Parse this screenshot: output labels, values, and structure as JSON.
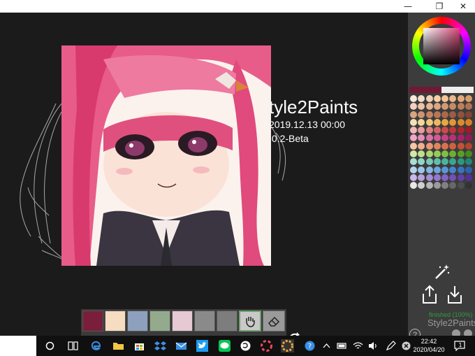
{
  "window": {
    "minimize_glyph": "—",
    "restore_glyph": "❐",
    "close_glyph": "✕"
  },
  "splash": {
    "app_name": "tyle2Paints",
    "build_date": "2019.12.13 00:00",
    "version": ".0.2-Beta"
  },
  "sidebar": {
    "collapse_glyph": "‹",
    "primary_color": "#6e1a37",
    "secondary_color": "#eeeeee",
    "palette": [
      "#f7e9dd",
      "#f3dcc8",
      "#efd1b7",
      "#f5cfa7",
      "#f0c494",
      "#e9b889",
      "#e2aa79",
      "#d89c6c",
      "#f1d0c0",
      "#ecc3a6",
      "#e6b593",
      "#dea683",
      "#d49874",
      "#c98a66",
      "#bf7e5b",
      "#b27252",
      "#d9a47f",
      "#cf9470",
      "#c48463",
      "#b77657",
      "#a9694d",
      "#9c5d45",
      "#8f523d",
      "#7f4635",
      "#f4e2b8",
      "#f2d79b",
      "#efca7c",
      "#eab95e",
      "#e6a844",
      "#e39636",
      "#df8a2b",
      "#dc7f23",
      "#f1b8b8",
      "#e89c9c",
      "#e07f80",
      "#d76264",
      "#cc494d",
      "#c0353b",
      "#b0262e",
      "#9c1b25",
      "#f0a6c8",
      "#e78cb8",
      "#dd71a6",
      "#d25896",
      "#c74285",
      "#b93075",
      "#a82366",
      "#951959",
      "#f6c7a4",
      "#f1b08c",
      "#e99874",
      "#e2835f",
      "#d9704e",
      "#cf6041",
      "#c35236",
      "#b4452c",
      "#d4e8a6",
      "#bfe08a",
      "#a9d66f",
      "#93cc58",
      "#7ebf45",
      "#69b034",
      "#589f28",
      "#478c1e",
      "#a8e0d2",
      "#8fd6c5",
      "#77cab7",
      "#5fbfa9",
      "#4bb39b",
      "#39a68d",
      "#2b9880",
      "#1f8973",
      "#b5d3ef",
      "#9dc4ea",
      "#86b5e4",
      "#6fa5de",
      "#5a95d6",
      "#4784cd",
      "#3773c1",
      "#2a63b2",
      "#c9b8ea",
      "#b8a2e2",
      "#a68cd9",
      "#9577cf",
      "#8363c4",
      "#7350b8",
      "#633fa9",
      "#543198",
      "#e8e8e8",
      "#cfcfcf",
      "#b5b5b5",
      "#9b9b9b",
      "#818181",
      "#676767",
      "#4d4d4d",
      "#333333"
    ],
    "status": "finished (100%)",
    "app_label": "Style2Paints",
    "help": "?"
  },
  "swatches": [
    "#7a1e3c",
    "#f6dcc0",
    "#8da0bd",
    "#93ab8c",
    "#e6c9d2",
    "#8a8a8a",
    "#7d7d7d"
  ],
  "taskbar": {
    "clock_time": "22:42",
    "clock_date": "2020/04/20",
    "notification_count": "1"
  }
}
